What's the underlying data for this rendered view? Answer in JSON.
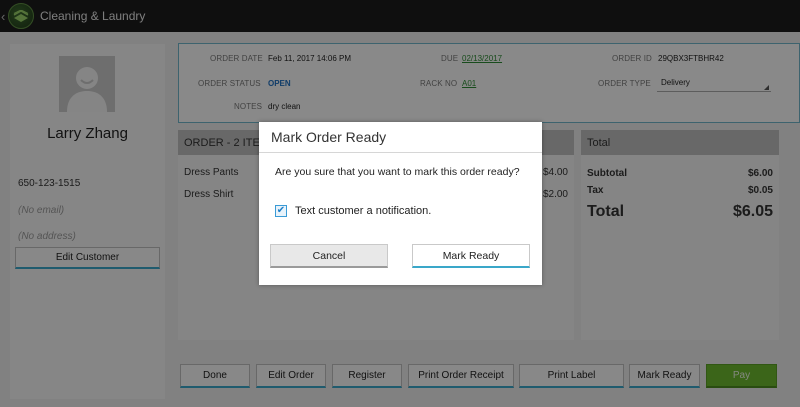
{
  "app": {
    "title": "Cleaning & Laundry",
    "back_glyph": "‹"
  },
  "customer": {
    "name": "Larry Zhang",
    "phone": "650-123-1515",
    "email_placeholder": "(No email)",
    "address_placeholder": "(No address)",
    "edit_button": "Edit Customer"
  },
  "order": {
    "order_date_label": "ORDER DATE",
    "order_date": "Feb 11, 2017 14:06 PM",
    "due_label": "DUE",
    "due": "02/13/2017",
    "order_id_label": "ORDER ID",
    "order_id": "29QBX3FTBHR42",
    "status_label": "ORDER STATUS",
    "status": "OPEN",
    "rack_label": "RACK NO",
    "rack": "A01",
    "type_label": "ORDER TYPE",
    "type": "Delivery",
    "notes_label": "NOTES",
    "notes": "dry clean"
  },
  "items": {
    "header": "ORDER - 2 ITE",
    "rows": [
      {
        "name": "Dress Pants",
        "price": "$4.00"
      },
      {
        "name": "Dress Shirt",
        "price": "$2.00"
      }
    ]
  },
  "totals": {
    "header": "Total",
    "subtotal_label": "Subtotal",
    "subtotal": "$6.00",
    "tax_label": "Tax",
    "tax": "$0.05",
    "total_label": "Total",
    "total": "$6.05"
  },
  "actions": {
    "done": "Done",
    "edit_order": "Edit Order",
    "register": "Register",
    "print_receipt": "Print Order Receipt",
    "print_label": "Print Label",
    "mark_ready": "Mark Ready",
    "pay": "Pay"
  },
  "dialog": {
    "title": "Mark Order Ready",
    "message": "Are you sure that you want to mark this order ready?",
    "checkbox_label": "Text customer a notification.",
    "checkbox_checked": true,
    "cancel": "Cancel",
    "confirm": "Mark Ready"
  },
  "colors": {
    "accent": "#3aa7c9",
    "pay_green": "#6cb82f",
    "link_green": "#2c8a33",
    "status_blue": "#1f6fbf"
  }
}
